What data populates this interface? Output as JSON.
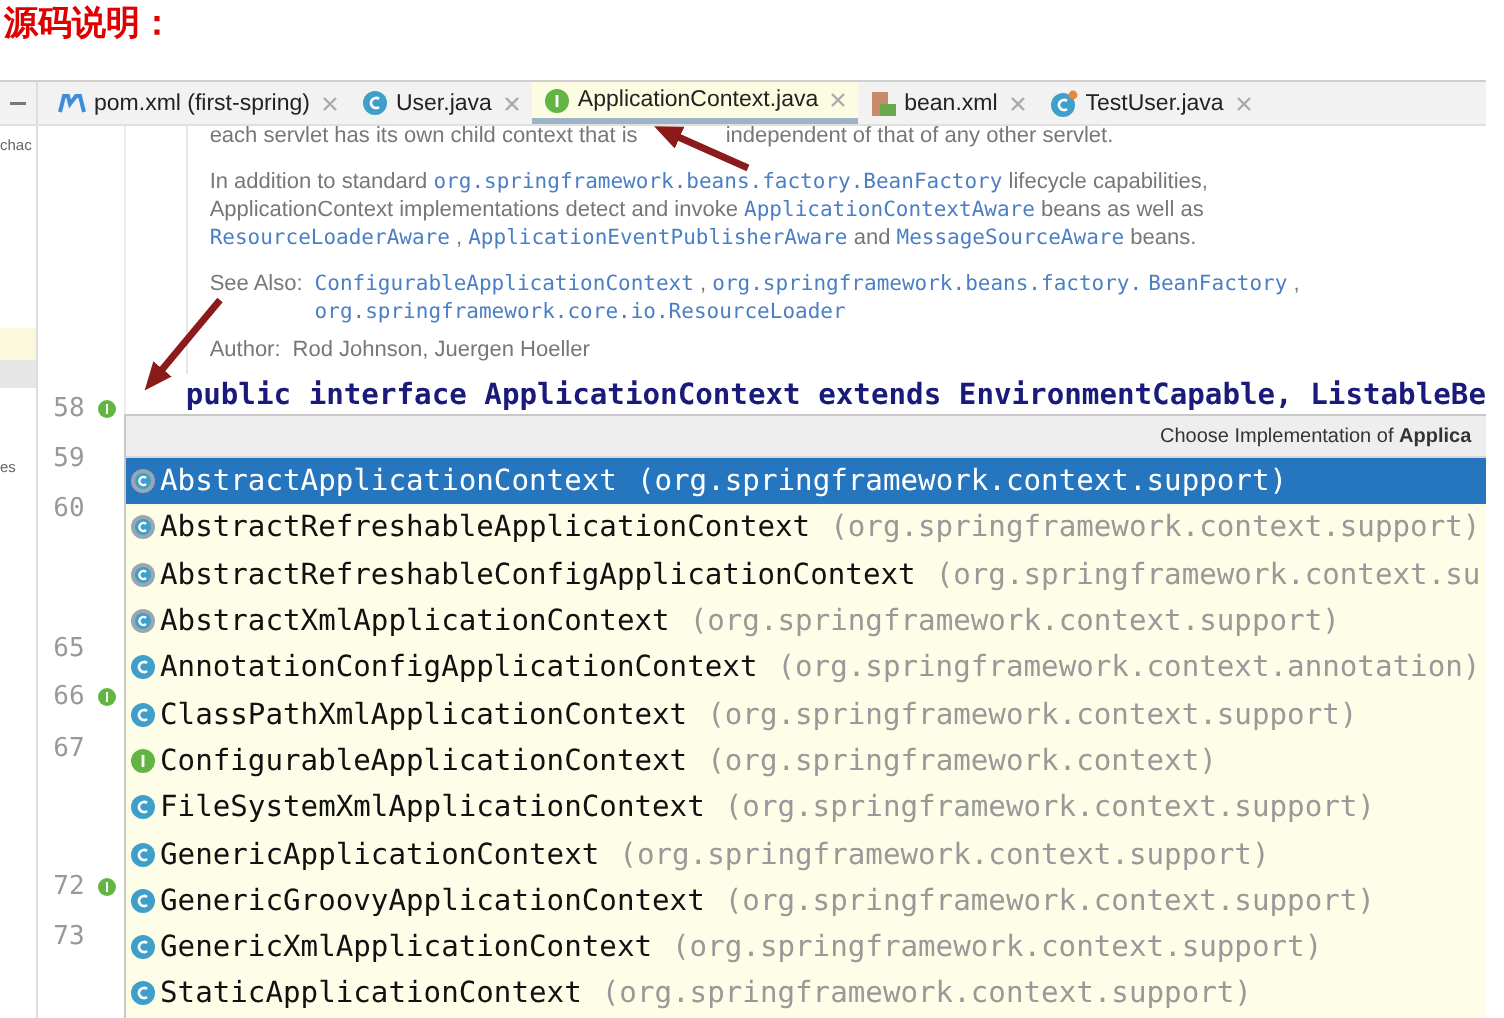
{
  "heading": "源码说明：",
  "left_panel": {
    "fragments": [
      "chac",
      "es"
    ]
  },
  "tabs": [
    {
      "label": "pom.xml (first-spring)",
      "kind": "maven",
      "selected": false
    },
    {
      "label": "User.java",
      "kind": "class",
      "selected": false
    },
    {
      "label": "ApplicationContext.java",
      "kind": "interface",
      "selected": true
    },
    {
      "label": "bean.xml",
      "kind": "xml",
      "selected": false
    },
    {
      "label": "TestUser.java",
      "kind": "test",
      "selected": false
    }
  ],
  "doc": {
    "paragraphs": [
      {
        "kind": "split",
        "parts": [
          {
            "kind": "text",
            "text": "each servlet has its own child context that is"
          },
          {
            "kind": "text",
            "text": "independent of that of any other servlet."
          }
        ]
      },
      {
        "kind": "text",
        "parts": [
          {
            "kind": "text",
            "text": "In addition to standard"
          },
          {
            "kind": "code",
            "text": "org.springframework.beans.factory.BeanFactory"
          },
          {
            "kind": "text",
            "text": "lifecycle capabilities, ApplicationContext implementations detect and invoke"
          },
          {
            "kind": "code",
            "text": "ApplicationContextAware"
          },
          {
            "kind": "text",
            "text": "beans as well as"
          },
          {
            "kind": "code",
            "text": "ResourceLoaderAware"
          },
          {
            "kind": "text",
            "text": ","
          },
          {
            "kind": "code",
            "text": "ApplicationEventPublisherAware"
          },
          {
            "kind": "text",
            "text": "and"
          },
          {
            "kind": "code",
            "text": "MessageSourceAware"
          },
          {
            "kind": "text",
            "text": "beans."
          }
        ]
      },
      {
        "kind": "labeled",
        "label": "See Also:",
        "parts": [
          {
            "kind": "code",
            "text": "ConfigurableApplicationContext"
          },
          {
            "kind": "text",
            "text": ","
          },
          {
            "kind": "code",
            "text": "org.springframework.beans.factory."
          },
          {
            "kind": "code",
            "text": "BeanFactory"
          },
          {
            "kind": "text",
            "text": ","
          },
          {
            "kind": "code",
            "text": "org.springframework.core.io.ResourceLoader"
          }
        ]
      },
      {
        "kind": "labeled",
        "label": "Author:",
        "parts": [
          {
            "kind": "text",
            "text": "Rod Johnson, Juergen Hoeller"
          }
        ]
      }
    ]
  },
  "code_line": "public interface ApplicationContext extends EnvironmentCapable, ListableBe",
  "gutter": [
    {
      "number": "58",
      "marker": true
    },
    {
      "number": "59",
      "marker": false
    },
    {
      "number": "60",
      "marker": false
    },
    {
      "number": "65",
      "marker": false
    },
    {
      "number": "66",
      "marker": true
    },
    {
      "number": "67",
      "marker": false
    },
    {
      "number": "72",
      "marker": true
    },
    {
      "number": "73",
      "marker": false
    }
  ],
  "popup": {
    "title": "Choose Implementation of **Applica**",
    "items": [
      {
        "name": "AbstractApplicationContext",
        "package": "(org.springframework.context.support)",
        "kind": "abstract",
        "selected": true
      },
      {
        "name": "AbstractRefreshableApplicationContext",
        "package": "(org.springframework.context.support)",
        "kind": "abstract",
        "selected": false
      },
      {
        "name": "AbstractRefreshableConfigApplicationContext",
        "package": "(org.springframework.context.su",
        "kind": "abstract",
        "selected": false
      },
      {
        "name": "AbstractXmlApplicationContext",
        "package": "(org.springframework.context.support)",
        "kind": "abstract",
        "selected": false
      },
      {
        "name": "AnnotationConfigApplicationContext",
        "package": "(org.springframework.context.annotation)",
        "kind": "class",
        "selected": false
      },
      {
        "name": "ClassPathXmlApplicationContext",
        "package": "(org.springframework.context.support)",
        "kind": "class",
        "selected": false
      },
      {
        "name": "ConfigurableApplicationContext",
        "package": "(org.springframework.context)",
        "kind": "interface",
        "selected": false
      },
      {
        "name": "FileSystemXmlApplicationContext",
        "package": "(org.springframework.context.support)",
        "kind": "class",
        "selected": false
      },
      {
        "name": "GenericApplicationContext",
        "package": "(org.springframework.context.support)",
        "kind": "class",
        "selected": false
      },
      {
        "name": "GenericGroovyApplicationContext",
        "package": "(org.springframework.context.support)",
        "kind": "class",
        "selected": false
      },
      {
        "name": "GenericXmlApplicationContext",
        "package": "(org.springframework.context.support)",
        "kind": "class",
        "selected": false
      },
      {
        "name": "StaticApplicationContext",
        "package": "(org.springframework.context.support)",
        "kind": "class",
        "selected": false
      }
    ]
  }
}
